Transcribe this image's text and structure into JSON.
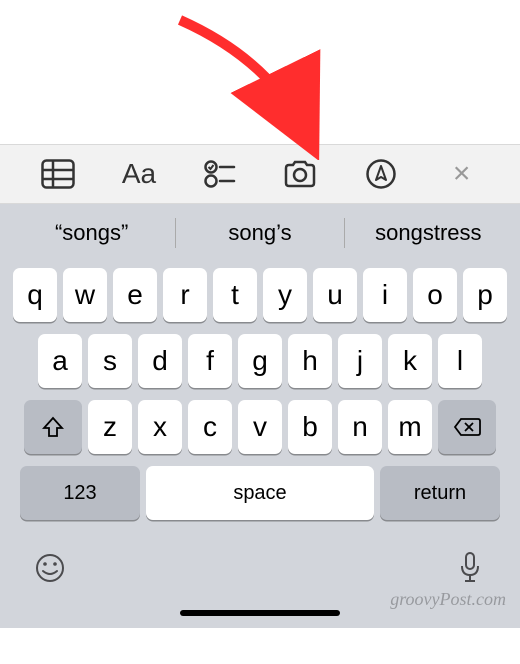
{
  "toolbar": {
    "text_format_label": "Aa",
    "close_label": "×"
  },
  "suggestions": {
    "items": [
      "“songs”",
      "song’s",
      "songstress"
    ]
  },
  "keyboard": {
    "row1": [
      "q",
      "w",
      "e",
      "r",
      "t",
      "y",
      "u",
      "i",
      "o",
      "p"
    ],
    "row2": [
      "a",
      "s",
      "d",
      "f",
      "g",
      "h",
      "j",
      "k",
      "l"
    ],
    "row3": [
      "z",
      "x",
      "c",
      "v",
      "b",
      "n",
      "m"
    ],
    "num_label": "123",
    "space_label": "space",
    "return_label": "return"
  },
  "watermark": "groovyPost.com"
}
